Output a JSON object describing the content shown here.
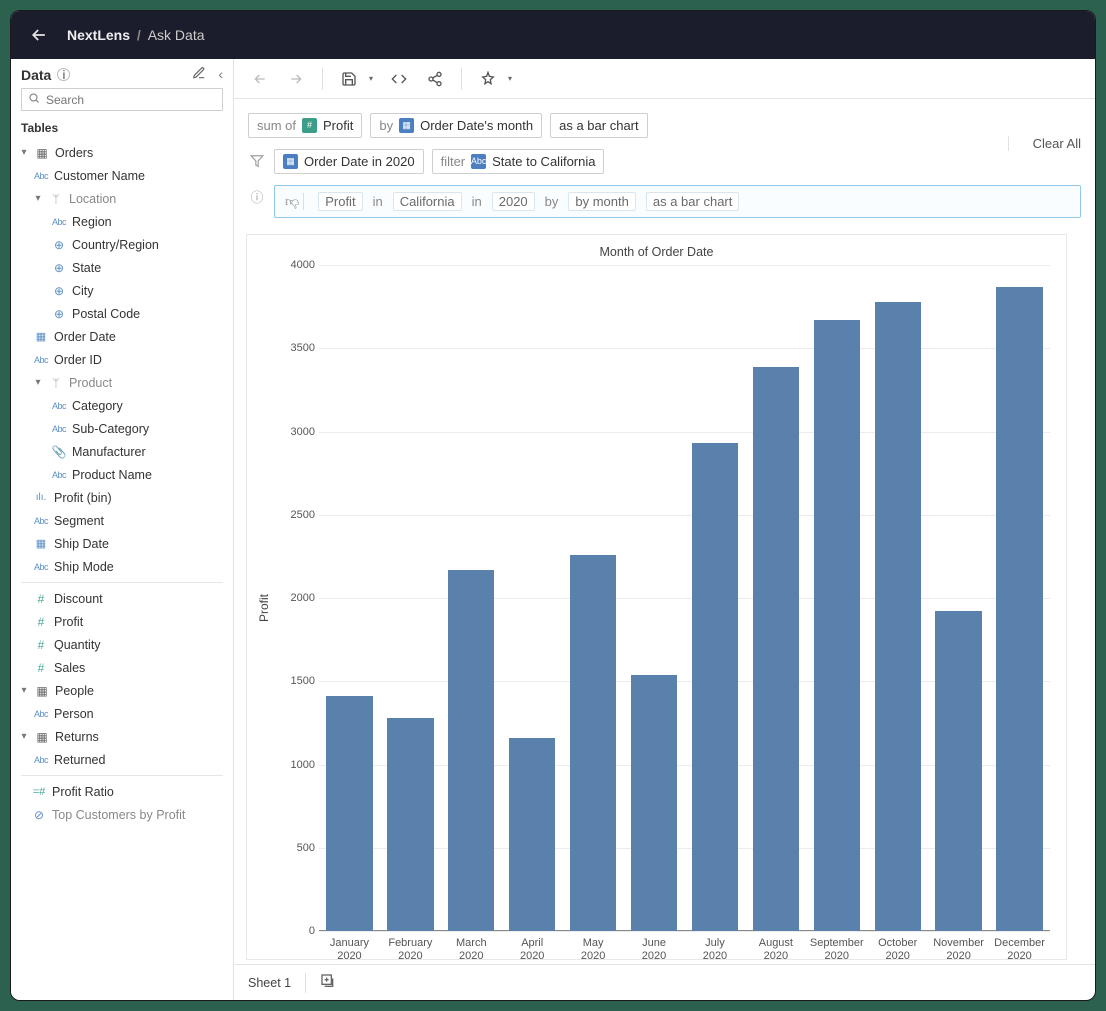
{
  "header": {
    "crumb1": "NextLens",
    "sep": "/",
    "crumb2": "Ask Data"
  },
  "sidebar": {
    "title": "Data",
    "search_placeholder": "Search",
    "section_label": "Tables",
    "tables": {
      "orders": {
        "label": "Orders",
        "fields": {
          "customer_name": "Customer Name",
          "location": "Location",
          "region": "Region",
          "country_region": "Country/Region",
          "state": "State",
          "city": "City",
          "postal_code": "Postal Code",
          "order_date": "Order Date",
          "order_id": "Order ID",
          "product": "Product",
          "category": "Category",
          "sub_category": "Sub-Category",
          "manufacturer": "Manufacturer",
          "product_name": "Product Name",
          "profit_bin": "Profit (bin)",
          "segment": "Segment",
          "ship_date": "Ship Date",
          "ship_mode": "Ship Mode",
          "discount": "Discount",
          "profit": "Profit",
          "quantity": "Quantity",
          "sales": "Sales"
        }
      },
      "people": {
        "label": "People",
        "fields": {
          "person": "Person"
        }
      },
      "returns": {
        "label": "Returns",
        "fields": {
          "returned": "Returned"
        }
      }
    },
    "calcs": {
      "profit_ratio": "Profit Ratio",
      "top_customers": "Top Customers by Profit"
    }
  },
  "pills": {
    "sum_of": "sum of",
    "profit": "Profit",
    "by": "by",
    "order_date_month": "Order Date's month",
    "as_bar": "as a bar chart",
    "filter_date": "Order Date in 2020",
    "filter_label": "filter",
    "filter_state": "State to California",
    "clear_all": "Clear All"
  },
  "query": {
    "tok_profit": "Profit",
    "in": "in",
    "tok_california": "California",
    "in2": "in",
    "tok_2020": "2020",
    "by": "by",
    "tok_bymonth": "by month",
    "tok_barchart": "as a bar chart"
  },
  "footer": {
    "sheet": "Sheet 1"
  },
  "chart_data": {
    "type": "bar",
    "title": "Month of Order Date",
    "ylabel": "Profit",
    "ylim": [
      0,
      4000
    ],
    "yticks": [
      0,
      500,
      1000,
      1500,
      2000,
      2500,
      3000,
      3500,
      4000
    ],
    "categories": [
      "January 2020",
      "February 2020",
      "March 2020",
      "April 2020",
      "May 2020",
      "June 2020",
      "July 2020",
      "August 2020",
      "September 2020",
      "October 2020",
      "November 2020",
      "December 2020"
    ],
    "values": [
      1410,
      1280,
      2170,
      1160,
      2260,
      1540,
      2930,
      3390,
      3670,
      3780,
      1920,
      3870
    ],
    "bar_color": "#5a81ac"
  }
}
